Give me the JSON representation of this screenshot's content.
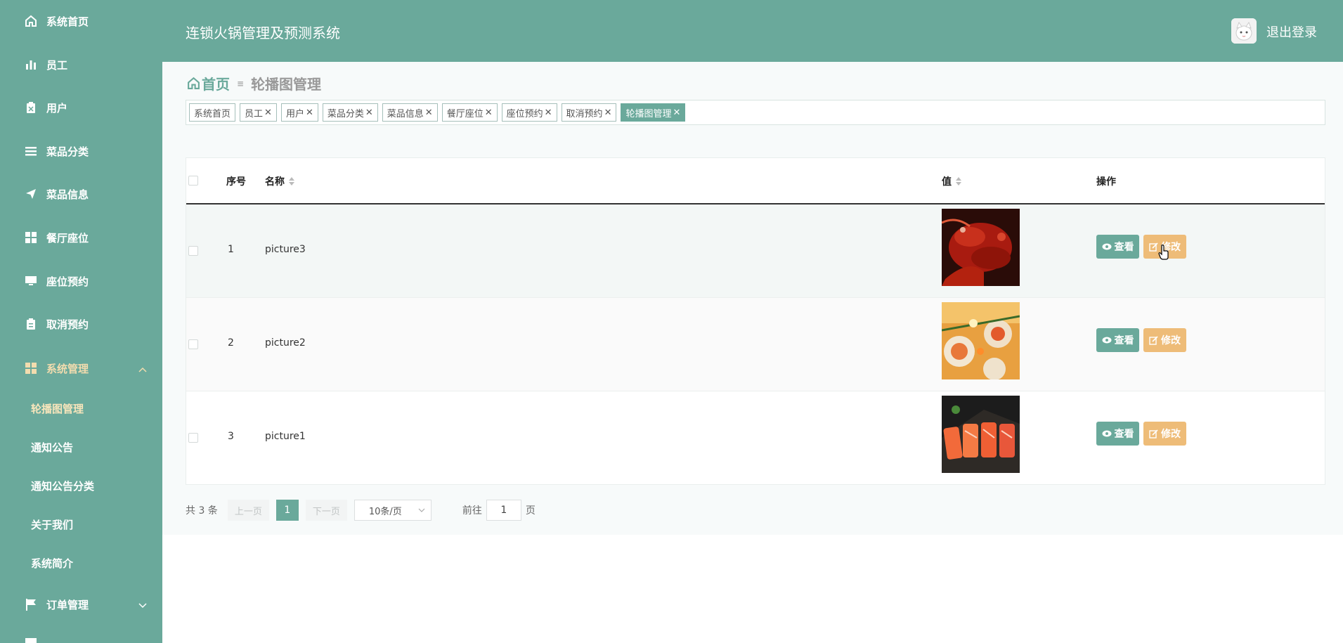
{
  "app": {
    "title": "连锁火锅管理及预测系统",
    "logout_label": "退出登录"
  },
  "sidebar": {
    "items": [
      {
        "label": "系统首页",
        "icon": "home-icon"
      },
      {
        "label": "员工",
        "icon": "bar-chart-icon"
      },
      {
        "label": "用户",
        "icon": "user-clipboard-icon"
      },
      {
        "label": "菜品分类",
        "icon": "list-icon"
      },
      {
        "label": "菜品信息",
        "icon": "paper-plane-icon"
      },
      {
        "label": "餐厅座位",
        "icon": "grid-icon"
      },
      {
        "label": "座位预约",
        "icon": "monitor-icon"
      },
      {
        "label": "取消预约",
        "icon": "clipboard-icon"
      },
      {
        "label": "系统管理",
        "icon": "grid-icon",
        "expanded": true
      },
      {
        "label": "订单管理",
        "icon": "flag-icon",
        "expanded": false
      }
    ],
    "subitems": [
      {
        "label": "轮播图管理",
        "active": true
      },
      {
        "label": "通知公告"
      },
      {
        "label": "通知公告分类"
      },
      {
        "label": "关于我们"
      },
      {
        "label": "系统简介"
      }
    ]
  },
  "breadcrumb": {
    "home": "首页",
    "current": "轮播图管理"
  },
  "tags": [
    {
      "label": "系统首页",
      "closable": false
    },
    {
      "label": "员工",
      "closable": true
    },
    {
      "label": "用户",
      "closable": true
    },
    {
      "label": "菜品分类",
      "closable": true
    },
    {
      "label": "菜品信息",
      "closable": true
    },
    {
      "label": "餐厅座位",
      "closable": true
    },
    {
      "label": "座位预约",
      "closable": true
    },
    {
      "label": "取消预约",
      "closable": true
    },
    {
      "label": "轮播图管理",
      "closable": true,
      "active": true
    }
  ],
  "table": {
    "headers": {
      "index": "序号",
      "name": "名称",
      "value": "值",
      "actions": "操作"
    },
    "rows": [
      {
        "index": "1",
        "name": "picture3",
        "image": "lobster"
      },
      {
        "index": "2",
        "name": "picture2",
        "image": "sushi-roll"
      },
      {
        "index": "3",
        "name": "picture1",
        "image": "salmon-nigiri"
      }
    ],
    "view_label": "查看",
    "edit_label": "修改"
  },
  "pagination": {
    "total": "共 3 条",
    "prev": "上一页",
    "current_page": "1",
    "next": "下一页",
    "page_size": "10条/页",
    "goto_label": "前往",
    "goto_value": "1",
    "page_unit": "页"
  },
  "colors": {
    "primary": "#6aa99b",
    "warning": "#eebc78",
    "active_menu": "#f2dcae"
  }
}
